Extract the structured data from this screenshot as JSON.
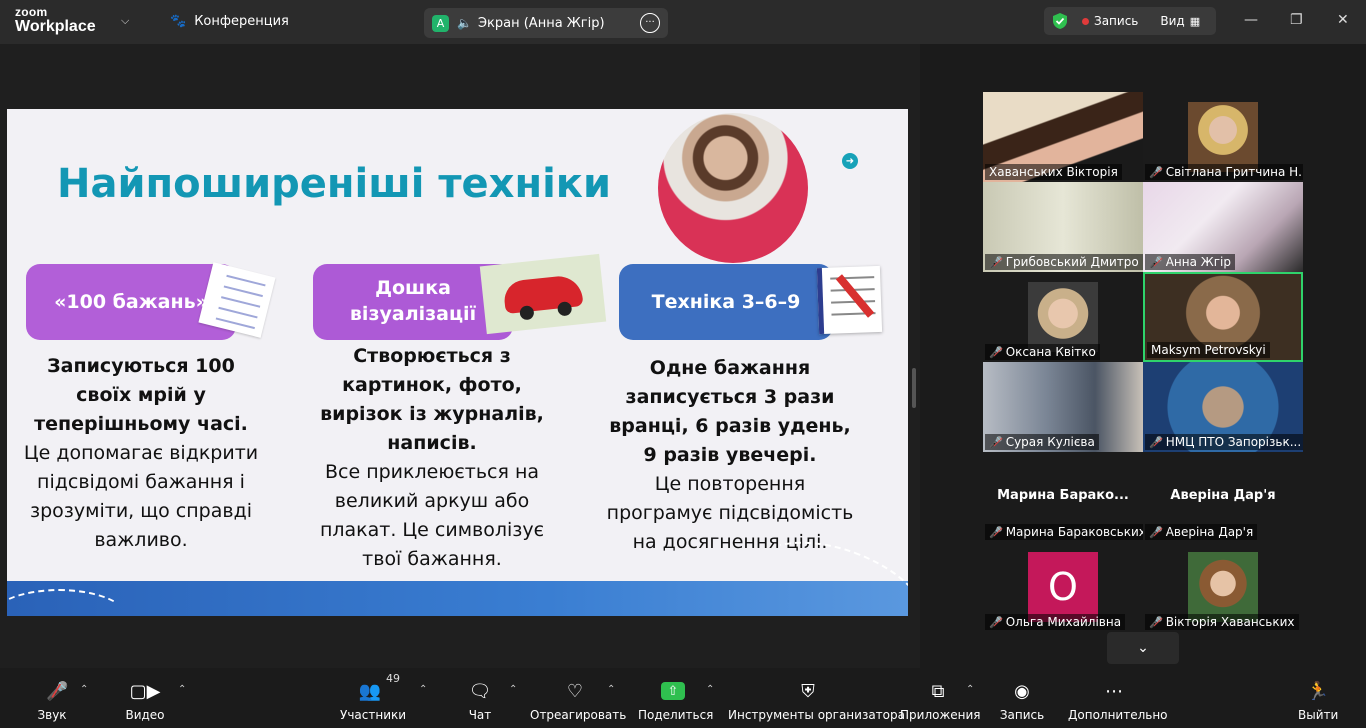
{
  "topbar": {
    "logo_small": "zoom",
    "logo_big": "Workplace",
    "conference": "Конференция",
    "screen_avatar": "A",
    "screen_title": "Экран (Анна Жгір)",
    "record": "Запись",
    "view": "Вид"
  },
  "slide": {
    "title": "Найпоширеніші техніки",
    "pill1": "«100 бажань»",
    "pill2": "Дошка візуалізації",
    "pill3": "Техніка 3–6–9",
    "col1_bold": "Записуються 100 своїх мрій у теперішньому часі.",
    "col1_text": "Це допомагає відкрити підсвідомі бажання і зрозуміти, що справді важливо.",
    "col2_bold": "Створюється з картинок, фото, вирізок із журналів, написів.",
    "col2_text": "Все приклеюється на великий аркуш або плакат. Це символізує твої бажання.",
    "col3_bold": "Одне бажання записується 3 рази вранці, 6 разів удень, 9 разів увечері.",
    "col3_text": "Це повторення програмує підсвідомість на досягнення цілі."
  },
  "participants": [
    {
      "name": "Хаванських Вікторія",
      "muted": false
    },
    {
      "name": "Світлана Гритчина Н...",
      "muted": true
    },
    {
      "name": "Грибовський Дмитро",
      "muted": true
    },
    {
      "name": "Анна Жгір",
      "muted": true
    },
    {
      "name": "Оксана Квітко",
      "muted": true
    },
    {
      "name": "Maksym Petrovskyi",
      "muted": false
    },
    {
      "name": "Сурая Кулієва",
      "muted": true
    },
    {
      "name": "НМЦ ПТО Запорізьк...",
      "muted": true
    },
    {
      "name": "Марина Бараковських",
      "muted": true,
      "header": "Марина  Барако..."
    },
    {
      "name": "Аверіна Дар'я",
      "muted": true,
      "header": "Аверіна Дар'я"
    },
    {
      "name": "Ольга Михайлівна",
      "muted": true,
      "initial": "О"
    },
    {
      "name": "Вікторія Хаванських",
      "muted": true
    }
  ],
  "toolbar": {
    "audio": "Звук",
    "video": "Видео",
    "participants": "Участники",
    "participants_count": "49",
    "chat": "Чат",
    "react": "Отреагировать",
    "share": "Поделиться",
    "host_tools": "Инструменты организатора",
    "apps": "Приложения",
    "record": "Запись",
    "more": "Дополнительно",
    "leave": "Выйти"
  },
  "colors": {
    "accent_teal": "#1397b4",
    "pill_purple": "#b25fd8",
    "pill_blue": "#3d6fc0",
    "share_green": "#2fbf4f",
    "rec_red": "#e03a3a"
  }
}
